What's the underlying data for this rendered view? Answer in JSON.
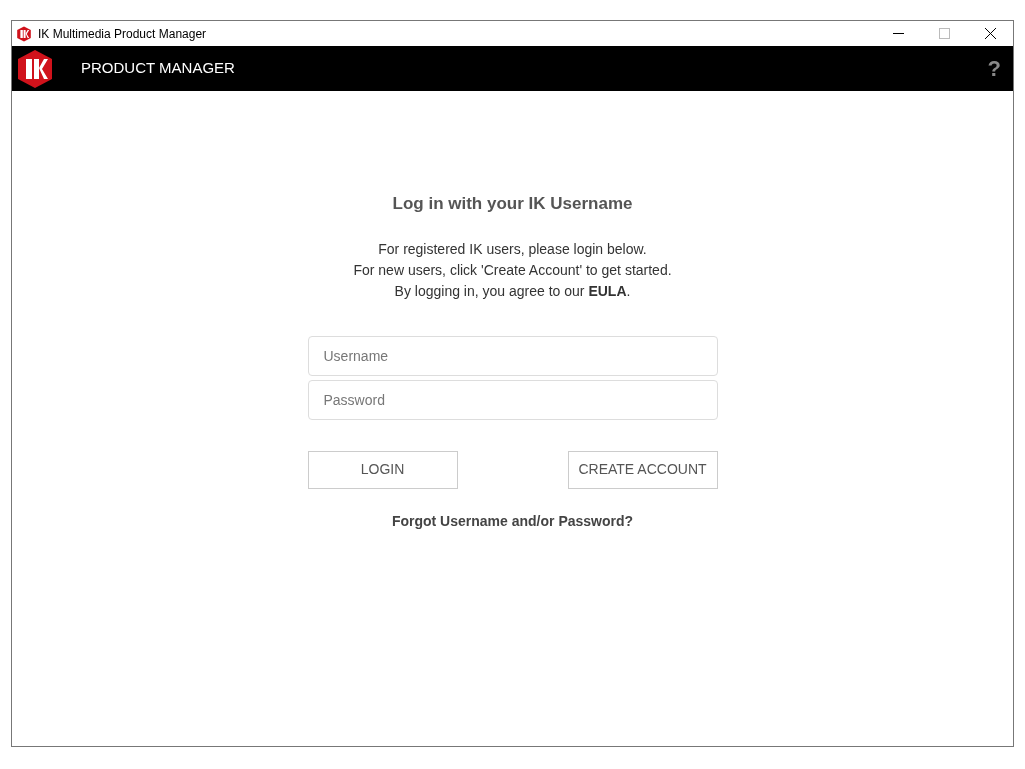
{
  "window": {
    "title": "IK Multimedia Product Manager"
  },
  "header": {
    "title": "PRODUCT MANAGER",
    "help": "?"
  },
  "login": {
    "heading": "Log in with your IK Username",
    "intro": [
      "For registered IK users, please login below.",
      "For new users, click 'Create Account' to get started.",
      "By logging in, you agree to our **EULA**."
    ],
    "fields": [
      {
        "placeholder": "Username"
      },
      {
        "placeholder": "Password"
      }
    ],
    "buttons": [
      "LOGIN",
      "CREATE ACCOUNT"
    ],
    "forgot": "Forgot Username and/or Password?"
  }
}
